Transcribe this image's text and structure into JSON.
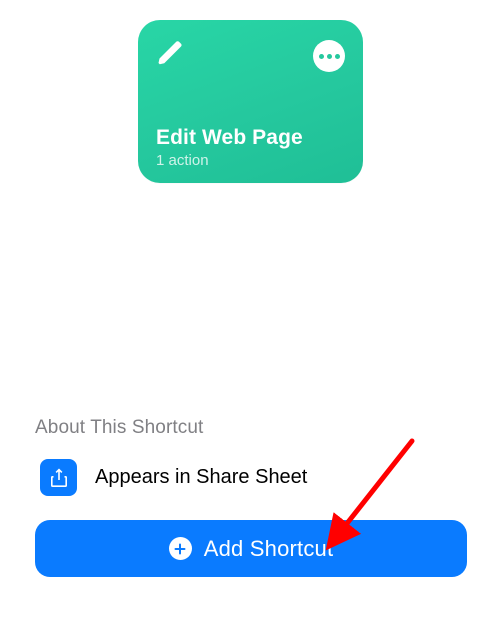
{
  "shortcut_tile": {
    "title": "Edit Web Page",
    "subtitle": "1 action",
    "icon": "pencil-icon",
    "tile_color": "#25c89e"
  },
  "about": {
    "heading": "About This Shortcut",
    "share_sheet_label": "Appears in Share Sheet",
    "share_icon": "share-icon",
    "share_color": "#0a7bff"
  },
  "add_button": {
    "label": "Add Shortcut",
    "icon": "plus-circle-icon",
    "button_color": "#0a7bff"
  },
  "annotation": {
    "arrow_color": "#ff0000"
  }
}
